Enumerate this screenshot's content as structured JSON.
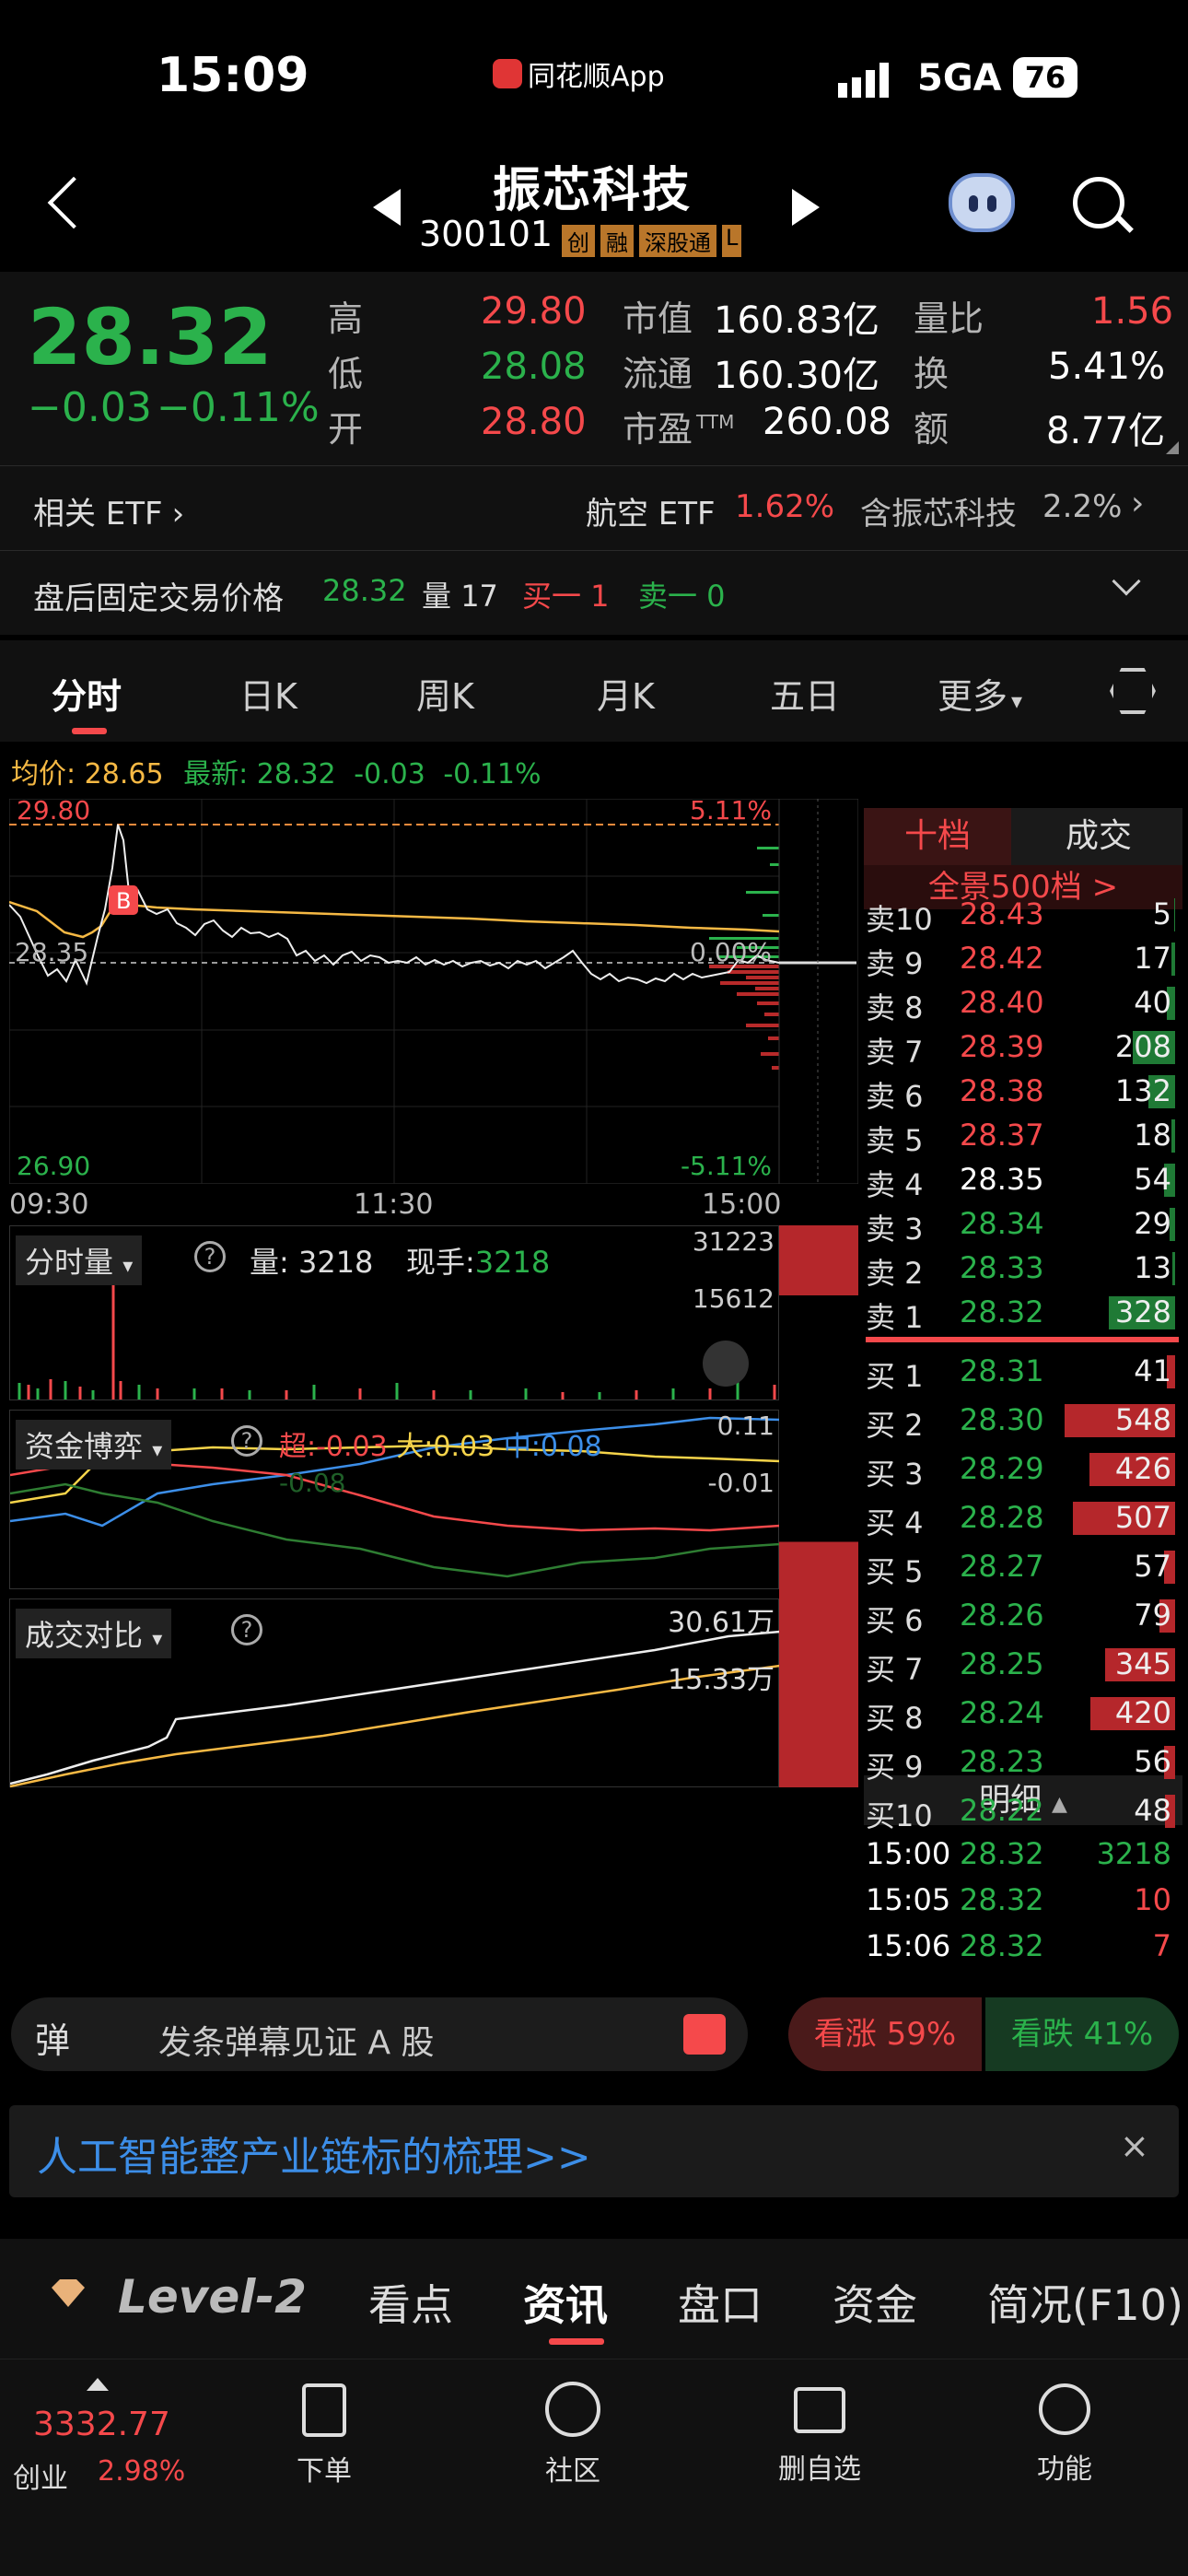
{
  "status": {
    "time": "15:09",
    "app_tag": "同花顺App",
    "network": "5GA",
    "battery": "76"
  },
  "nav": {
    "title": "振芯科技",
    "code": "300101",
    "badges": [
      "创",
      "融",
      "深股通",
      "L"
    ]
  },
  "quote": {
    "price": "28.32",
    "change": "−0.03",
    "change_pct": "−0.11%",
    "high_label": "高",
    "high": "29.80",
    "low_label": "低",
    "low": "28.08",
    "open_label": "开",
    "open": "28.80",
    "mktcap_label": "市值",
    "mktcap": "160.83亿",
    "float_label": "流通",
    "float": "160.30亿",
    "pe_label": "市盈",
    "pe_sup": "TTM",
    "pe": "260.08",
    "volratio_label": "量比",
    "volratio": "1.56",
    "turnover_label": "换",
    "turnover": "5.41%",
    "amount_label": "额",
    "amount": "8.77亿"
  },
  "etf": {
    "label": "相关 ETF",
    "name": "航空 ETF",
    "pct": "1.62%",
    "contains": "含振芯科技",
    "weight": "2.2%"
  },
  "afterhours": {
    "label": "盘后固定交易价格",
    "price": "28.32",
    "vol_label": "量",
    "vol": "17",
    "buy_label": "买一 1",
    "sell_label": "卖一 0"
  },
  "tabs": [
    "分时",
    "日K",
    "周K",
    "月K",
    "五日",
    "更多"
  ],
  "chart": {
    "avg_label": "均价:",
    "avg": "28.65",
    "latest_label": "最新:",
    "latest": "28.32",
    "latest_chg": "-0.03",
    "latest_pct": "-0.11%",
    "top_price": "29.80",
    "top_pct": "5.11%",
    "mid_price": "28.35",
    "mid_pct": "0.00%",
    "bot_price": "26.90",
    "bot_pct": "-5.11%",
    "times": [
      "09:30",
      "11:30",
      "15:00"
    ],
    "b_marker": "B",
    "vol_panel": {
      "label": "分时量",
      "vol_label": "量:",
      "vol": "3218",
      "hand_label": "现手:",
      "hand": "3218",
      "max": "31223",
      "mid": "15612"
    },
    "flow_panel": {
      "label": "资金博弈",
      "super": "超:-0.03",
      "big": "大:0.03",
      "mid": "中:0.08",
      "top": "0.11",
      "low": "-0.01",
      "small": "-0.08"
    },
    "compare_panel": {
      "label": "成交对比",
      "v1": "30.61万",
      "v2": "15.33万"
    }
  },
  "orderbook": {
    "tab_active": "十档",
    "tab_other": "成交",
    "full_label": "全景500档 >",
    "asks": [
      {
        "l": "卖10",
        "p": "28.43",
        "v": "5"
      },
      {
        "l": "卖 9",
        "p": "28.42",
        "v": "17"
      },
      {
        "l": "卖 8",
        "p": "28.40",
        "v": "40"
      },
      {
        "l": "卖 7",
        "p": "28.39",
        "v": "208"
      },
      {
        "l": "卖 6",
        "p": "28.38",
        "v": "132"
      },
      {
        "l": "卖 5",
        "p": "28.37",
        "v": "18"
      },
      {
        "l": "卖 4",
        "p": "28.35",
        "v": "54"
      },
      {
        "l": "卖 3",
        "p": "28.34",
        "v": "29"
      },
      {
        "l": "卖 2",
        "p": "28.33",
        "v": "13"
      },
      {
        "l": "卖 1",
        "p": "28.32",
        "v": "328"
      }
    ],
    "bids": [
      {
        "l": "买 1",
        "p": "28.31",
        "v": "41"
      },
      {
        "l": "买 2",
        "p": "28.30",
        "v": "548"
      },
      {
        "l": "买 3",
        "p": "28.29",
        "v": "426"
      },
      {
        "l": "买 4",
        "p": "28.28",
        "v": "507"
      },
      {
        "l": "买 5",
        "p": "28.27",
        "v": "57"
      },
      {
        "l": "买 6",
        "p": "28.26",
        "v": "79"
      },
      {
        "l": "买 7",
        "p": "28.25",
        "v": "345"
      },
      {
        "l": "买 8",
        "p": "28.24",
        "v": "420"
      },
      {
        "l": "买 9",
        "p": "28.23",
        "v": "56"
      },
      {
        "l": "买10",
        "p": "28.22",
        "v": "48"
      }
    ],
    "detail_label": "明细",
    "details": [
      {
        "t": "15:00",
        "p": "28.32",
        "v": "3218"
      },
      {
        "t": "15:05",
        "p": "28.32",
        "v": "10"
      },
      {
        "t": "15:06",
        "p": "28.32",
        "v": "7"
      }
    ]
  },
  "danmu": {
    "icon": "弹",
    "placeholder": "发条弹幕见证 A 股",
    "up": "看涨 59%",
    "down": "看跌 41%"
  },
  "banner": {
    "text": "人工智能整产业链标的梳理>>"
  },
  "infotabs": [
    "Level-2",
    "看点",
    "资讯",
    "盘口",
    "资金",
    "简况(F10)"
  ],
  "bottom": {
    "index_value": "3332.77",
    "index_name": "创业",
    "index_pct": "2.98%",
    "items": [
      "下单",
      "社区",
      "删自选",
      "功能"
    ]
  },
  "colors": {
    "up": "#f5494b",
    "down": "#2bb24c",
    "avg": "#f6b944"
  }
}
